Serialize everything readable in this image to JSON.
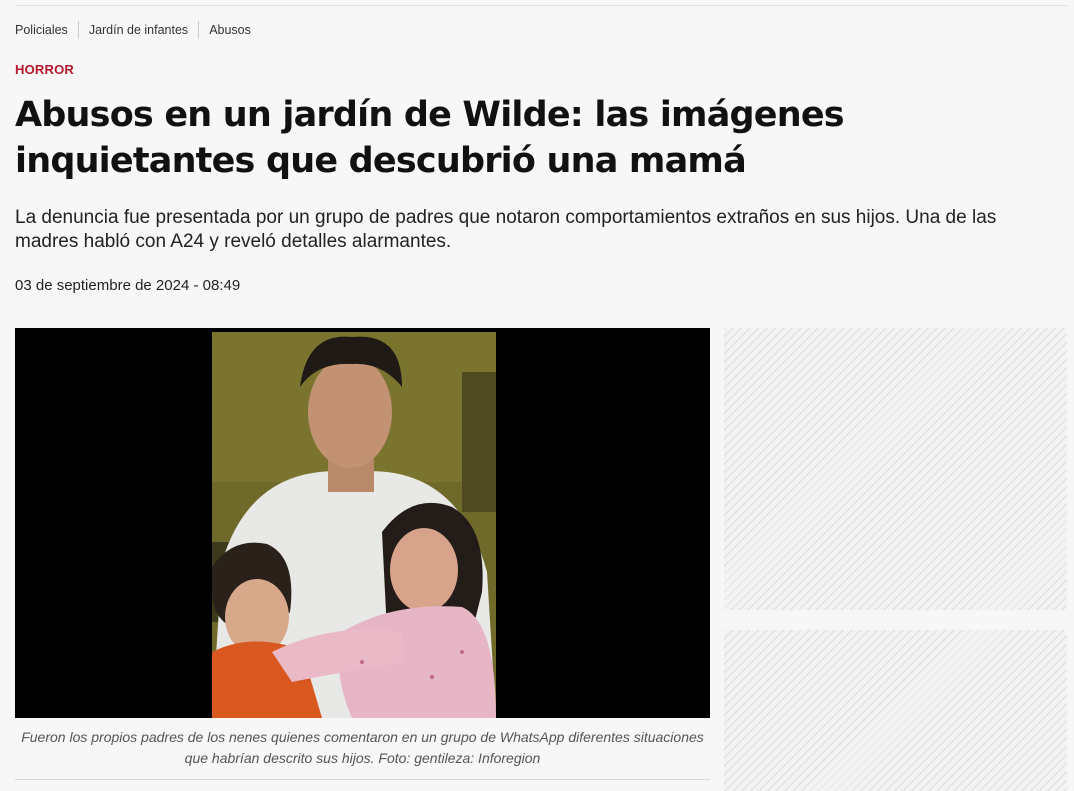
{
  "breadcrumbs": [
    "Policiales",
    "Jardín de infantes",
    "Abusos"
  ],
  "article": {
    "kicker": "HORROR",
    "title": "Abusos en un jardín de Wilde: las imágenes inquietantes que descubrió una mamá",
    "lead": "La denuncia fue presentada por un grupo de padres que notaron comportamientos extraños en sus hijos. Una de las madres habló con A24 y reveló detalles alarmantes.",
    "date": "03 de septiembre de 2024 - 08:49",
    "image_caption": "Fueron los propios padres de los nenes quienes comentaron en un grupo de WhatsApp diferentes situaciones que habrían descrito sus hijos. Foto: gentileza: Inforegion"
  },
  "colors": {
    "kicker": "#b5172b",
    "background": "#f7f7f7"
  }
}
